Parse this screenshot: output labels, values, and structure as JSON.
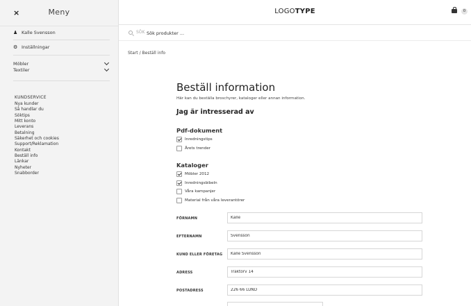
{
  "sidebar": {
    "close_label": "×",
    "title": "Meny",
    "user": "Kalle Svensson",
    "settings": "Inställningar",
    "categories": [
      {
        "label": "Möbler"
      },
      {
        "label": "Textiler"
      }
    ],
    "service_heading": "KUNDSERVICE",
    "service_links": [
      "Nya kunder",
      "Så handlar du",
      "Söktips",
      "Mitt konto",
      "Leverans",
      "Betalning",
      "Säkerhet och cookies",
      "Support/Reklamation",
      "Kontakt",
      "Beställ info",
      "Länkar",
      "Nyheter",
      "Snabborder"
    ]
  },
  "header": {
    "logo_light": "LOGO",
    "logo_bold": "TYPE",
    "cart_count": "0"
  },
  "search": {
    "label": "SÖK",
    "placeholder": "Sök produkter ..."
  },
  "breadcrumb": {
    "home": "Start",
    "separator": "/",
    "current": "Beställ info"
  },
  "main": {
    "title": "Beställ information",
    "intro": "Här kan du beställa broschyrer, kataloger eller annan information.",
    "section_title": "Jag är intresserad av",
    "pdf_group": {
      "title": "Pdf-dokument",
      "items": [
        {
          "label": "Inredningstips",
          "checked": true
        },
        {
          "label": "Årets trender",
          "checked": false
        }
      ]
    },
    "catalog_group": {
      "title": "Kataloger",
      "items": [
        {
          "label": "Möbler 2012",
          "checked": true
        },
        {
          "label": "Inredningsbibeln",
          "checked": true
        },
        {
          "label": "Våra kampanjer",
          "checked": false
        },
        {
          "label": "Material från våra leverantörer",
          "checked": false
        }
      ]
    },
    "form": {
      "fornamn_label": "FÖRNAMN",
      "fornamn_value": "Kalle",
      "efternamn_label": "EFTERNAMN",
      "efternamn_value": "Svensson",
      "kund_label": "KUND ELLER FÖRETAG",
      "kund_value": "Kalle Svensson",
      "adress_label": "ADRESS",
      "adress_value": "Traktorv 14",
      "postadress_label": "POSTADRESS",
      "postadress_value": "226 66 LUND"
    }
  }
}
